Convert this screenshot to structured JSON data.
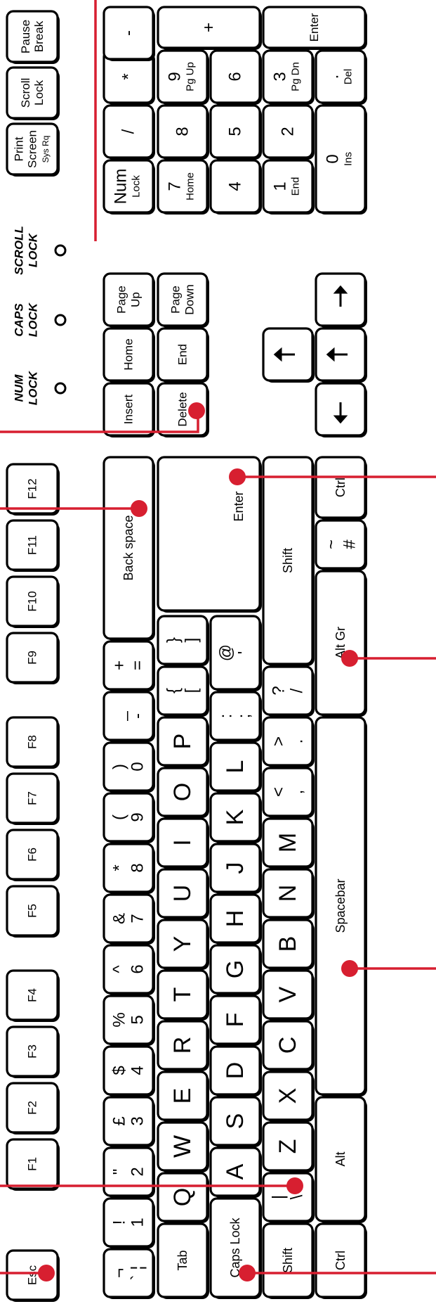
{
  "diagram": {
    "function_row": [
      {
        "id": "esc",
        "label": "Esc"
      },
      {
        "id": "f1",
        "label": "F1"
      },
      {
        "id": "f2",
        "label": "F2"
      },
      {
        "id": "f3",
        "label": "F3"
      },
      {
        "id": "f4",
        "label": "F4"
      },
      {
        "id": "f5",
        "label": "F5"
      },
      {
        "id": "f6",
        "label": "F6"
      },
      {
        "id": "f7",
        "label": "F7"
      },
      {
        "id": "f8",
        "label": "F8"
      },
      {
        "id": "f9",
        "label": "F9"
      },
      {
        "id": "f10",
        "label": "F10"
      },
      {
        "id": "f11",
        "label": "F11"
      },
      {
        "id": "f12",
        "label": "F12"
      }
    ],
    "system_keys": [
      {
        "id": "print-screen",
        "lines": [
          "Print",
          "Screen",
          "Sys Rq"
        ]
      },
      {
        "id": "scroll-lock",
        "lines": [
          "Scroll",
          "Lock"
        ]
      },
      {
        "id": "pause-break",
        "lines": [
          "Pause",
          "Break"
        ]
      }
    ],
    "indicators": [
      {
        "id": "num-lock",
        "lines": [
          "NUM",
          "LOCK"
        ]
      },
      {
        "id": "caps-lock",
        "lines": [
          "CAPS",
          "LOCK"
        ]
      },
      {
        "id": "scroll-lock",
        "lines": [
          "SCROLL",
          "LOCK"
        ]
      }
    ],
    "number_row": [
      {
        "id": "backtick",
        "top": "¬",
        "bottom": "` ¦"
      },
      {
        "id": "1",
        "top": "!",
        "bottom": "1"
      },
      {
        "id": "2",
        "top": "\"",
        "bottom": "2"
      },
      {
        "id": "3",
        "top": "£",
        "bottom": "3"
      },
      {
        "id": "4",
        "top": "$",
        "bottom": "4"
      },
      {
        "id": "5",
        "top": "%",
        "bottom": "5"
      },
      {
        "id": "6",
        "top": "^",
        "bottom": "6"
      },
      {
        "id": "7",
        "top": "&",
        "bottom": "7"
      },
      {
        "id": "8",
        "top": "*",
        "bottom": "8"
      },
      {
        "id": "9",
        "top": "(",
        "bottom": "9"
      },
      {
        "id": "0",
        "top": ")",
        "bottom": "0"
      },
      {
        "id": "minus",
        "top": "_",
        "bottom": "-"
      },
      {
        "id": "equals",
        "top": "+",
        "bottom": "="
      },
      {
        "id": "backspace",
        "label": "Back space"
      }
    ],
    "qwerty_row": [
      {
        "id": "tab",
        "label": "Tab"
      },
      {
        "id": "q",
        "label": "Q"
      },
      {
        "id": "w",
        "label": "W"
      },
      {
        "id": "e",
        "label": "E"
      },
      {
        "id": "r",
        "label": "R"
      },
      {
        "id": "t",
        "label": "T"
      },
      {
        "id": "y",
        "label": "Y"
      },
      {
        "id": "u",
        "label": "U"
      },
      {
        "id": "i",
        "label": "I"
      },
      {
        "id": "o",
        "label": "O"
      },
      {
        "id": "p",
        "label": "P"
      },
      {
        "id": "lbracket",
        "top": "{",
        "bottom": "["
      },
      {
        "id": "rbracket",
        "top": "}",
        "bottom": "]"
      },
      {
        "id": "enter",
        "label": "Enter"
      }
    ],
    "home_row": [
      {
        "id": "caps",
        "label": "Caps Lock"
      },
      {
        "id": "a",
        "label": "A"
      },
      {
        "id": "s",
        "label": "S"
      },
      {
        "id": "d",
        "label": "D"
      },
      {
        "id": "f",
        "label": "F"
      },
      {
        "id": "g",
        "label": "G"
      },
      {
        "id": "h",
        "label": "H"
      },
      {
        "id": "j",
        "label": "J"
      },
      {
        "id": "k",
        "label": "K"
      },
      {
        "id": "l",
        "label": "L"
      },
      {
        "id": "semicolon",
        "top": ":",
        "bottom": ";"
      },
      {
        "id": "quote",
        "top": "@",
        "bottom": "'"
      }
    ],
    "shift_row": [
      {
        "id": "lshift",
        "label": "Shift"
      },
      {
        "id": "backslash",
        "top": "|",
        "bottom": "\\"
      },
      {
        "id": "z",
        "label": "Z"
      },
      {
        "id": "x",
        "label": "X"
      },
      {
        "id": "c",
        "label": "C"
      },
      {
        "id": "v",
        "label": "V"
      },
      {
        "id": "b",
        "label": "B"
      },
      {
        "id": "n",
        "label": "N"
      },
      {
        "id": "m",
        "label": "M"
      },
      {
        "id": "comma",
        "top": "<",
        "bottom": ","
      },
      {
        "id": "period",
        "top": ">",
        "bottom": "."
      },
      {
        "id": "slash",
        "top": "?",
        "bottom": "/"
      },
      {
        "id": "rshift",
        "label": "Shift"
      }
    ],
    "bottom_row": [
      {
        "id": "lctrl",
        "label": "Ctrl"
      },
      {
        "id": "alt",
        "label": "Alt"
      },
      {
        "id": "space",
        "label": "Spacebar"
      },
      {
        "id": "altgr",
        "label": "Alt Gr"
      },
      {
        "id": "hash",
        "top": "~",
        "bottom": "#"
      },
      {
        "id": "rctrl",
        "label": "Ctrl"
      }
    ],
    "nav_cluster": [
      {
        "id": "insert",
        "lines": [
          "Insert"
        ]
      },
      {
        "id": "home",
        "lines": [
          "Home"
        ]
      },
      {
        "id": "page-up",
        "lines": [
          "Page",
          "Up"
        ]
      },
      {
        "id": "delete",
        "lines": [
          "Delete"
        ]
      },
      {
        "id": "end",
        "lines": [
          "End"
        ]
      },
      {
        "id": "page-down",
        "lines": [
          "Page",
          "Down"
        ]
      }
    ],
    "numpad": [
      {
        "id": "num-lock",
        "lines": [
          "Num",
          "Lock"
        ]
      },
      {
        "id": "divide",
        "lines": [
          "/"
        ]
      },
      {
        "id": "multiply",
        "lines": [
          "*"
        ]
      },
      {
        "id": "subtract",
        "lines": [
          "-"
        ]
      },
      {
        "id": "num7",
        "lines": [
          "7",
          "Home"
        ]
      },
      {
        "id": "num8",
        "lines": [
          "8"
        ]
      },
      {
        "id": "num9",
        "lines": [
          "9",
          "Pg Up"
        ]
      },
      {
        "id": "add",
        "lines": [
          "+"
        ]
      },
      {
        "id": "num4",
        "lines": [
          "4"
        ]
      },
      {
        "id": "num5",
        "lines": [
          "5"
        ]
      },
      {
        "id": "num6",
        "lines": [
          "6"
        ]
      },
      {
        "id": "num1",
        "lines": [
          "1",
          "End"
        ]
      },
      {
        "id": "num2",
        "lines": [
          "2"
        ]
      },
      {
        "id": "num3",
        "lines": [
          "3",
          "Pg Dn"
        ]
      },
      {
        "id": "num-enter",
        "lines": [
          "Enter"
        ]
      },
      {
        "id": "num0",
        "lines": [
          "0",
          "Ins"
        ]
      },
      {
        "id": "decimal",
        "lines": [
          ".",
          "Del"
        ]
      }
    ],
    "colors": {
      "key_fill": "#ffffff",
      "key_outline": "#000000",
      "callout": "#d71f30"
    }
  }
}
